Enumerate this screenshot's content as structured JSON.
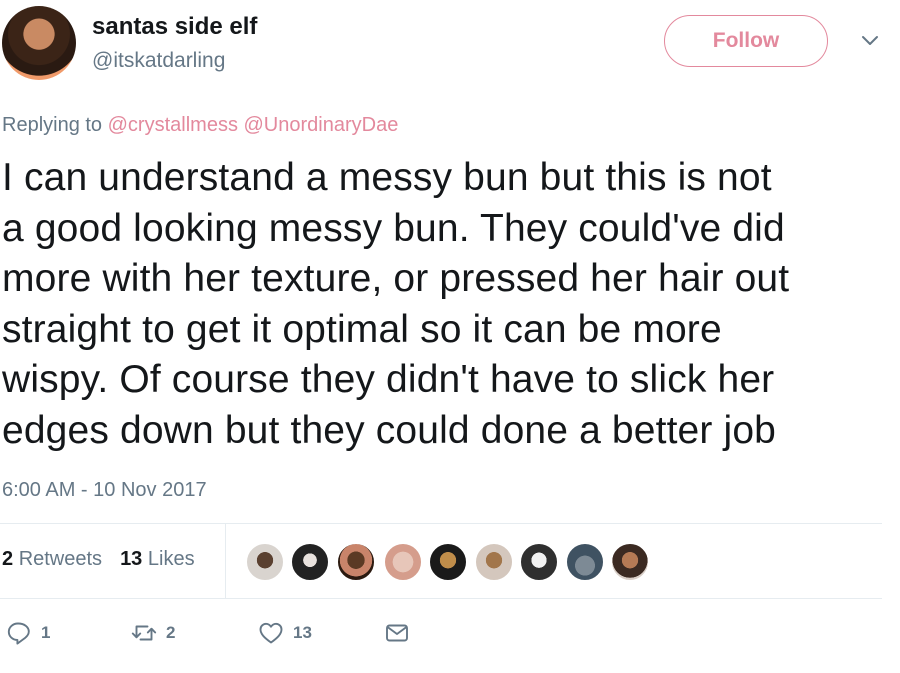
{
  "user": {
    "display_name": "santas side elf",
    "handle": "@itskatdarling"
  },
  "follow_label": "Follow",
  "reply": {
    "prefix": "Replying to",
    "mentions": [
      "@crystallmess",
      "@UnordinaryDae"
    ]
  },
  "tweet": {
    "lines": [
      "I can understand a messy bun but this is not",
      "a good looking messy bun. They could've did",
      "more with her texture, or pressed her hair out",
      "straight to get it optimal so it can be more",
      "wispy. Of course they didn't have to slick her",
      "edges down but they could done a better job"
    ],
    "timestamp": "6:00 AM - 10 Nov 2017"
  },
  "stats": {
    "retweets_count": "2",
    "retweets_label": "Retweets",
    "likes_count": "13",
    "likes_label": "Likes"
  },
  "actions": {
    "reply_count": "1",
    "retweet_count": "2",
    "like_count": "13"
  },
  "colors": {
    "accent": "#e3899d",
    "secondary_text": "#657786",
    "primary_text": "#14171a",
    "divider": "#e6ecf0"
  },
  "icons": [
    "chevron-down-icon",
    "reply-icon",
    "retweet-icon",
    "heart-icon",
    "message-icon"
  ]
}
